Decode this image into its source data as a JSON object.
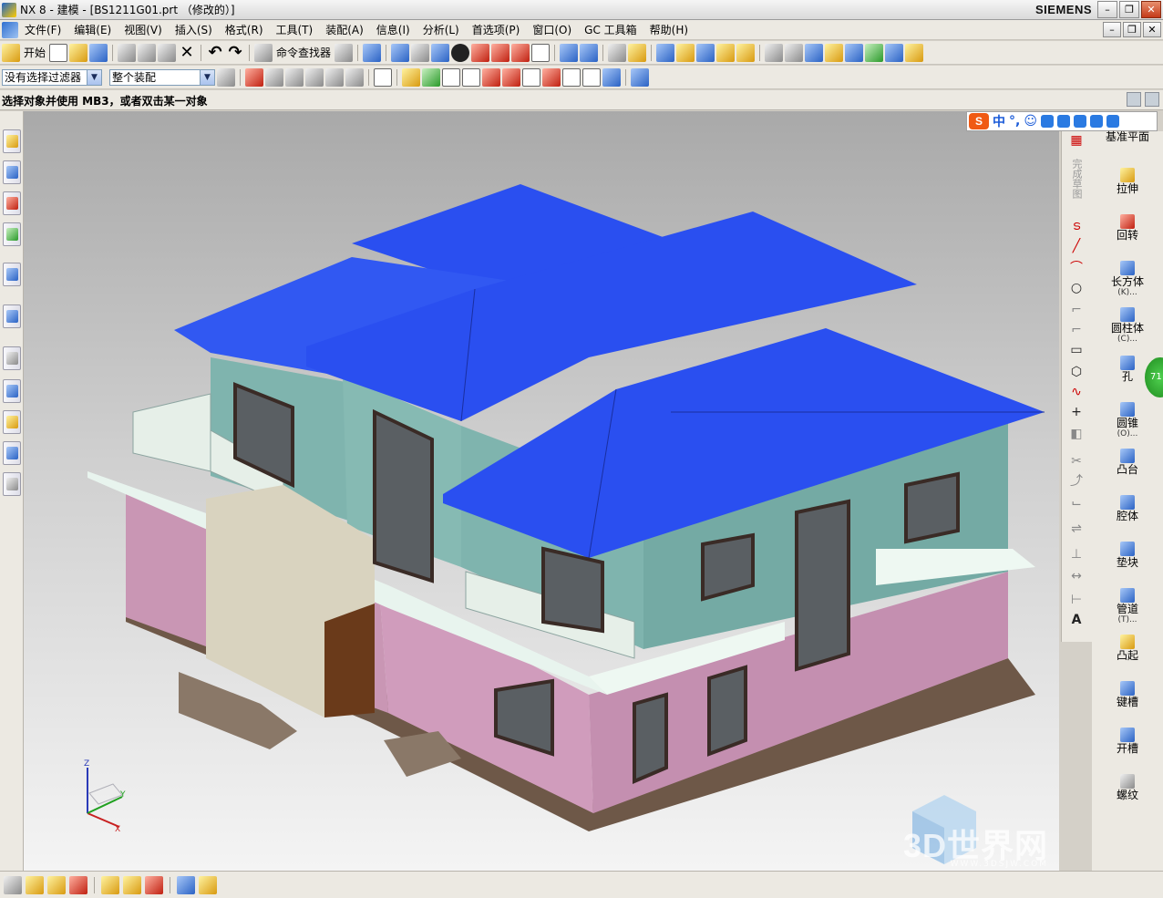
{
  "window": {
    "title": "NX 8 - 建模 - [BS1211G01.prt （修改的）]",
    "brand": "SIEMENS",
    "buttons": [
      "–",
      "❐",
      "✕"
    ]
  },
  "menu": {
    "items": [
      "文件(F)",
      "编辑(E)",
      "视图(V)",
      "插入(S)",
      "格式(R)",
      "工具(T)",
      "装配(A)",
      "信息(I)",
      "分析(L)",
      "首选项(P)",
      "窗口(O)",
      "GC 工具箱",
      "帮助(H)"
    ]
  },
  "toolbar1": {
    "start_label": "开始",
    "command_finder_label": "命令查找器"
  },
  "toolbar2": {
    "filter_value": "没有选择过滤器",
    "assembly_scope_value": "整个装配"
  },
  "prompt": {
    "text": "选择对象并使用 MB3，或者双击某一对象"
  },
  "ime": {
    "logo": "S",
    "items": [
      "中",
      "°,",
      "☺",
      "🎤",
      "⌨",
      "👤",
      "👕",
      "🔧"
    ]
  },
  "sketch_toolbar": {
    "label": "完成草图",
    "icons": [
      "sketch-icon",
      "line-icon",
      "arc-icon",
      "circle-icon",
      "fillet-icon",
      "chamfer-icon",
      "rectangle-icon",
      "polygon-icon",
      "studio-spline-icon",
      "point-icon",
      "offset-curve-icon",
      "trim-icon",
      "extend-icon",
      "corner-icon",
      "mirror-icon",
      "constraint-icon",
      "dimension-icon",
      "text-icon"
    ]
  },
  "feature_toolbar": {
    "items": [
      {
        "label": "基准平面",
        "sub": ""
      },
      {
        "label": "拉伸",
        "sub": ""
      },
      {
        "label": "回转",
        "sub": ""
      },
      {
        "label": "长方体",
        "sub": "(K)..."
      },
      {
        "label": "圆柱体",
        "sub": "(C)..."
      },
      {
        "label": "孔",
        "sub": ""
      },
      {
        "label": "圆锥",
        "sub": "(O)..."
      },
      {
        "label": "凸台",
        "sub": ""
      },
      {
        "label": "腔体",
        "sub": ""
      },
      {
        "label": "垫块",
        "sub": ""
      },
      {
        "label": "管道",
        "sub": "(T)..."
      },
      {
        "label": "凸起",
        "sub": ""
      },
      {
        "label": "键槽",
        "sub": ""
      },
      {
        "label": "开槽",
        "sub": ""
      },
      {
        "label": "螺纹",
        "sub": ""
      }
    ]
  },
  "notification_badge": "71",
  "triad": {
    "x": "X",
    "y": "Y",
    "z": "Z"
  },
  "watermark": {
    "text": "3D世界网",
    "sub": "WWW.3DSJW.COM"
  },
  "colors": {
    "roof": "#2a4ff0",
    "upper_wall": "#7fb4ae",
    "lower_wall": "#c996b4",
    "trim": "#e8f4ee",
    "base": "#6e5848",
    "window_frame": "#3a2b26",
    "viewport_top": "#a9a9a9",
    "viewport_bottom": "#f4f4f4"
  }
}
